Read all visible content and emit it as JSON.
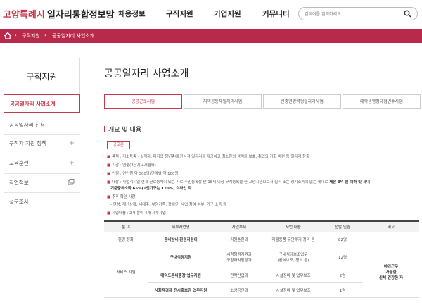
{
  "header": {
    "logo_city": "고양특례시",
    "logo_main": "일자리통합정보망",
    "nav": [
      "채용정보",
      "구직지원",
      "기업지원",
      "커뮤니티"
    ],
    "search_placeholder": "검색어를 입력하세요."
  },
  "breadcrumb": [
    "구직지원",
    "공공일자리 사업소개"
  ],
  "sidebar": {
    "title": "구직지원",
    "items": [
      {
        "label": "공공일자리 사업소개"
      },
      {
        "label": "공공일자리 신청"
      },
      {
        "label": "구직자 지원 정책"
      },
      {
        "label": "교육훈련"
      },
      {
        "label": "직업정보"
      },
      {
        "label": "설문조사"
      }
    ]
  },
  "main": {
    "title": "공공일자리 사업소개",
    "tabs": [
      "공공근로사업",
      "지역공동체일자리사업",
      "신중년경력형일자리사업",
      "대학생행정체험연수사업"
    ],
    "section_title": "개요 및 내용",
    "notice_label": "공고문",
    "bullets": [
      "목적 : 저소득층 · 실직자, 미취업 청년층에 한시적 일자리를 제공하고 최소한의 생계를 보호, 취업의 기회 마련 등 일자리 창출",
      "기간 : 연중(3단계 4개월씩)",
      "인원 : 연인원 약 300명(단계별 약 100명)",
      "대상 : 사업개시일 현재 근로능력이 있는 자로 주민등록상 만 18세 이상 구직등록을 한 고양시민으로서 실직 또는 정기소득이 없는 세대로",
      "기준중위소득 65%(1인가구는 120%) 이하인 자",
      "추후 확인 사항",
      "- 연령, 재산상황, 세대주, 부양가족, 장애인, 사업 참여 여부, 가구 소득 등",
      "사업내용 : 2개 분야 4개 세부사업"
    ],
    "bullet3_bold": "재산 3억 원 이하 및 세대",
    "table": {
      "headers": [
        "분 야",
        "세부사업명",
        "사업부서",
        "사업 내용",
        "선발 인원",
        "비고"
      ],
      "rows": [
        {
          "field": "환경 정화",
          "name": "동네방네 환경지킴이",
          "dept": "자원순환과",
          "content": "재활용품 무단투기 정리 등",
          "count": "82명",
          "note": ""
        },
        {
          "field": "서비스 지원",
          "name": "구내식당지원",
          "dept": "시청행정지원과\n구청자치행정과",
          "content": "구내식당보조업무\n(음식보조, 청소 등)",
          "count": "12명",
          "note": "야외근무\n가능한\n신체 건강한 자"
        },
        {
          "field": "",
          "name": "대덕드론비행장 업무지원",
          "dept": "전략산업과",
          "content": "시설정비 및 업무보조",
          "count": "2명",
          "note": ""
        },
        {
          "field": "",
          "name": "사회적경제 전시홍보관 업무지원",
          "dept": "소상공인과",
          "content": "시설정비 및 업무보조",
          "count": "1명",
          "note": ""
        }
      ]
    }
  }
}
